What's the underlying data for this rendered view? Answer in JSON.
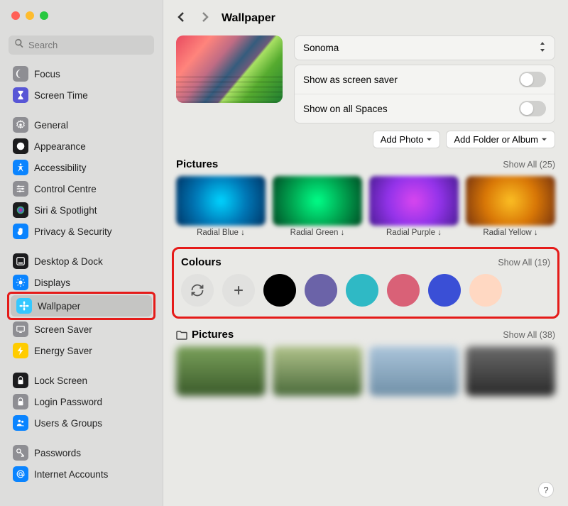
{
  "window": {
    "title": "Wallpaper"
  },
  "search": {
    "placeholder": "Search"
  },
  "sidebar": {
    "groups": [
      {
        "items": [
          {
            "label": "Focus",
            "icon": "moon",
            "iconbg": "#8e8e93"
          },
          {
            "label": "Screen Time",
            "icon": "hourglass",
            "iconbg": "#5856d6"
          }
        ]
      },
      {
        "items": [
          {
            "label": "General",
            "icon": "gear",
            "iconbg": "#8e8e93"
          },
          {
            "label": "Appearance",
            "icon": "appearance",
            "iconbg": "#1c1c1e"
          },
          {
            "label": "Accessibility",
            "icon": "accessibility",
            "iconbg": "#0a84ff"
          },
          {
            "label": "Control Centre",
            "icon": "sliders",
            "iconbg": "#8e8e93"
          },
          {
            "label": "Siri & Spotlight",
            "icon": "siri",
            "iconbg": "#1c1c1e"
          },
          {
            "label": "Privacy & Security",
            "icon": "hand",
            "iconbg": "#0a84ff"
          }
        ]
      },
      {
        "items": [
          {
            "label": "Desktop & Dock",
            "icon": "dock",
            "iconbg": "#1c1c1e"
          },
          {
            "label": "Displays",
            "icon": "sun",
            "iconbg": "#0a84ff"
          },
          {
            "label": "Wallpaper",
            "icon": "flower",
            "iconbg": "#34c8ff",
            "selected": true,
            "annotated": true
          },
          {
            "label": "Screen Saver",
            "icon": "screensaver",
            "iconbg": "#8e8e93"
          },
          {
            "label": "Energy Saver",
            "icon": "bolt",
            "iconbg": "#ffcc00"
          }
        ]
      },
      {
        "items": [
          {
            "label": "Lock Screen",
            "icon": "lock",
            "iconbg": "#1c1c1e"
          },
          {
            "label": "Login Password",
            "icon": "lockkey",
            "iconbg": "#8e8e93"
          },
          {
            "label": "Users & Groups",
            "icon": "users",
            "iconbg": "#0a84ff"
          }
        ]
      },
      {
        "items": [
          {
            "label": "Passwords",
            "icon": "key",
            "iconbg": "#8e8e93"
          },
          {
            "label": "Internet Accounts",
            "icon": "at",
            "iconbg": "#0a84ff"
          }
        ]
      }
    ]
  },
  "wallpaper_name": "Sonoma",
  "toggles": {
    "screen_saver": "Show as screen saver",
    "all_spaces": "Show on all Spaces"
  },
  "actions": {
    "add_photo": "Add Photo",
    "add_folder": "Add Folder or Album"
  },
  "sections": {
    "pictures1": {
      "title": "Pictures",
      "showall": "Show All (25)",
      "items": [
        {
          "label": "Radial Blue ↓"
        },
        {
          "label": "Radial Green ↓"
        },
        {
          "label": "Radial Purple ↓"
        },
        {
          "label": "Radial Yellow ↓"
        }
      ]
    },
    "colours": {
      "title": "Colours",
      "showall": "Show All (19)",
      "swatches": [
        {
          "hex": "#000000"
        },
        {
          "hex": "#6b63a8"
        },
        {
          "hex": "#2fb9c5"
        },
        {
          "hex": "#d96177"
        },
        {
          "hex": "#3a4fd6"
        },
        {
          "hex": "#ffd8c2"
        }
      ]
    },
    "pictures2": {
      "title": "Pictures",
      "showall": "Show All (38)"
    }
  },
  "help": "?"
}
